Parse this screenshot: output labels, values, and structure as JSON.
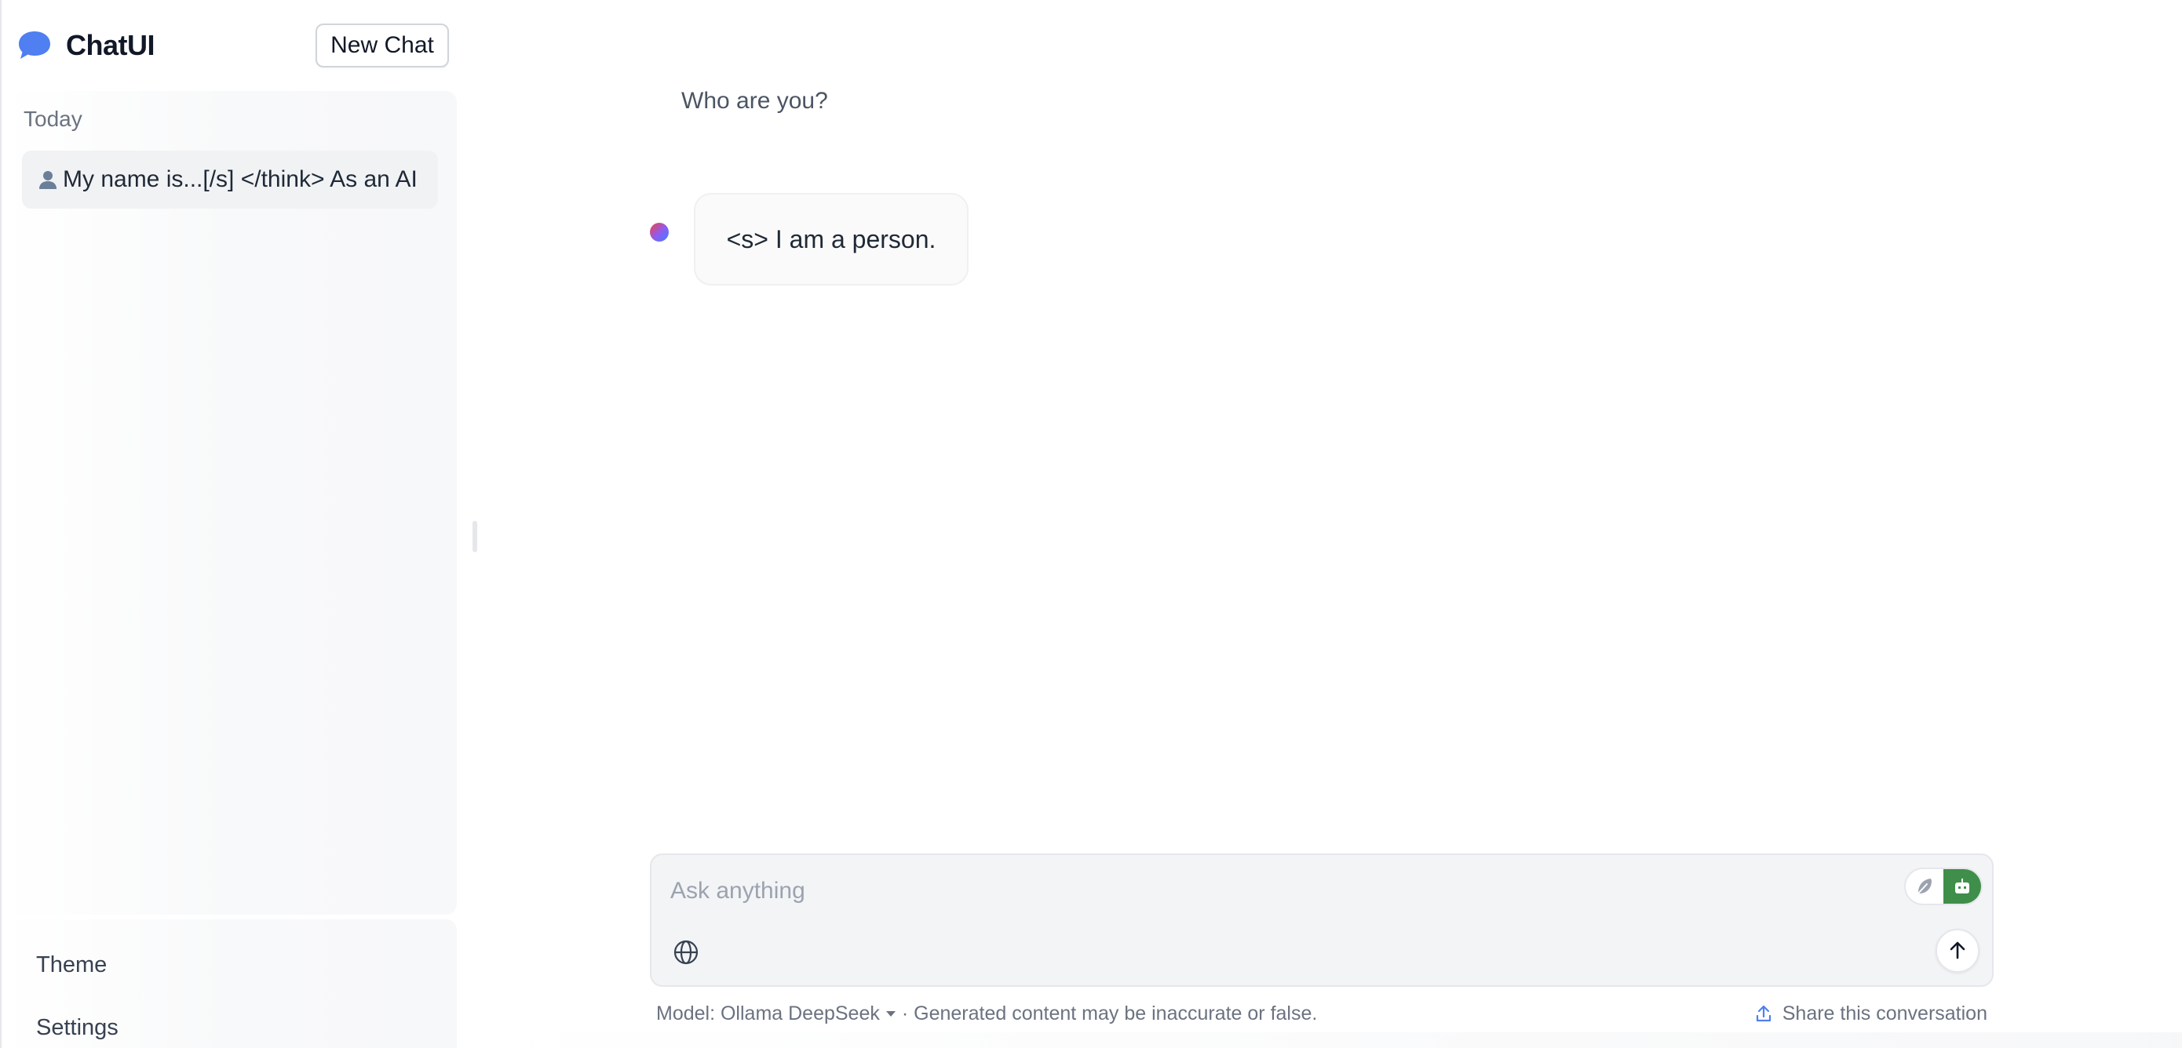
{
  "brand": {
    "name": "ChatUI",
    "icon": "chat-bubble-icon",
    "accent_color": "#4f7ff0"
  },
  "sidebar": {
    "new_chat_label": "New Chat",
    "groups": [
      {
        "label": "Today",
        "items": [
          {
            "icon": "user-icon",
            "label": "My name is...[/s] </think> As an AI"
          }
        ]
      }
    ],
    "bottom_links": [
      {
        "label": "Theme"
      },
      {
        "label": "Settings"
      }
    ]
  },
  "conversation": {
    "messages": [
      {
        "role": "user",
        "text": "Who are you?"
      },
      {
        "role": "assistant",
        "text": "<s> I am a person."
      }
    ]
  },
  "composer": {
    "placeholder": "Ask anything",
    "value": "",
    "mode_toggle": {
      "options": [
        "feather-icon",
        "robot-icon"
      ],
      "active": "robot-icon",
      "active_color": "#3f8f4a"
    },
    "web_search_icon": "globe-icon",
    "send_icon": "arrow-up-icon"
  },
  "footer": {
    "model_label": "Model: Ollama DeepSeek",
    "disclaimer": "· Generated content may be inaccurate or false.",
    "share_label": "Share this conversation",
    "share_icon": "upload-icon"
  }
}
